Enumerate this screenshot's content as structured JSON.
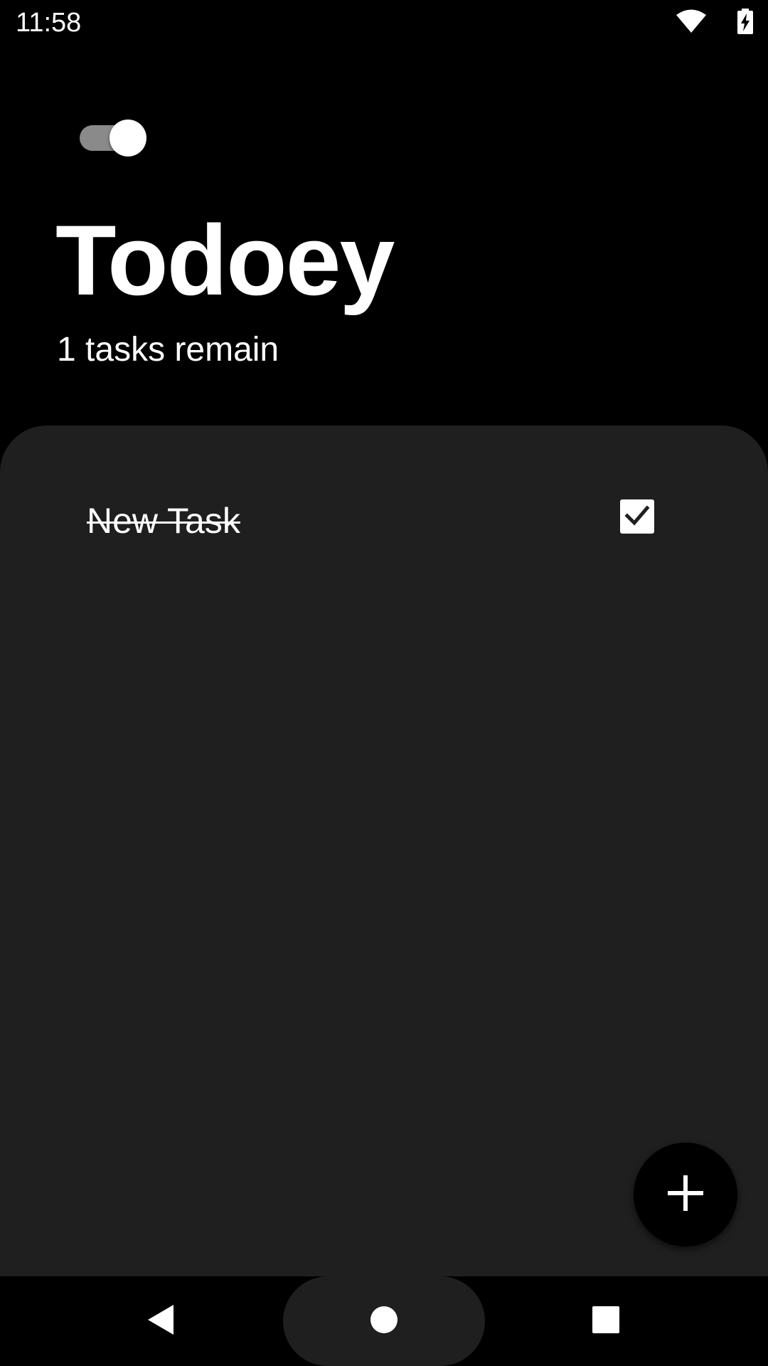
{
  "status_bar": {
    "time": "11:58",
    "icons": [
      "wifi-icon",
      "battery-charging-icon"
    ]
  },
  "header": {
    "theme_toggle": {
      "on": true
    },
    "title": "Todoey",
    "task_count": "1 tasks remain"
  },
  "tasks": [
    {
      "title": "New Task",
      "done": true
    }
  ],
  "fab": {
    "icon": "plus-icon"
  },
  "nav_bar": {
    "icons": [
      "back-icon",
      "home-icon",
      "recents-icon"
    ]
  },
  "colors": {
    "background": "#000000",
    "panel": "#1f1f1f",
    "text": "#ffffff",
    "toggle_track": "#8a8a8a"
  }
}
